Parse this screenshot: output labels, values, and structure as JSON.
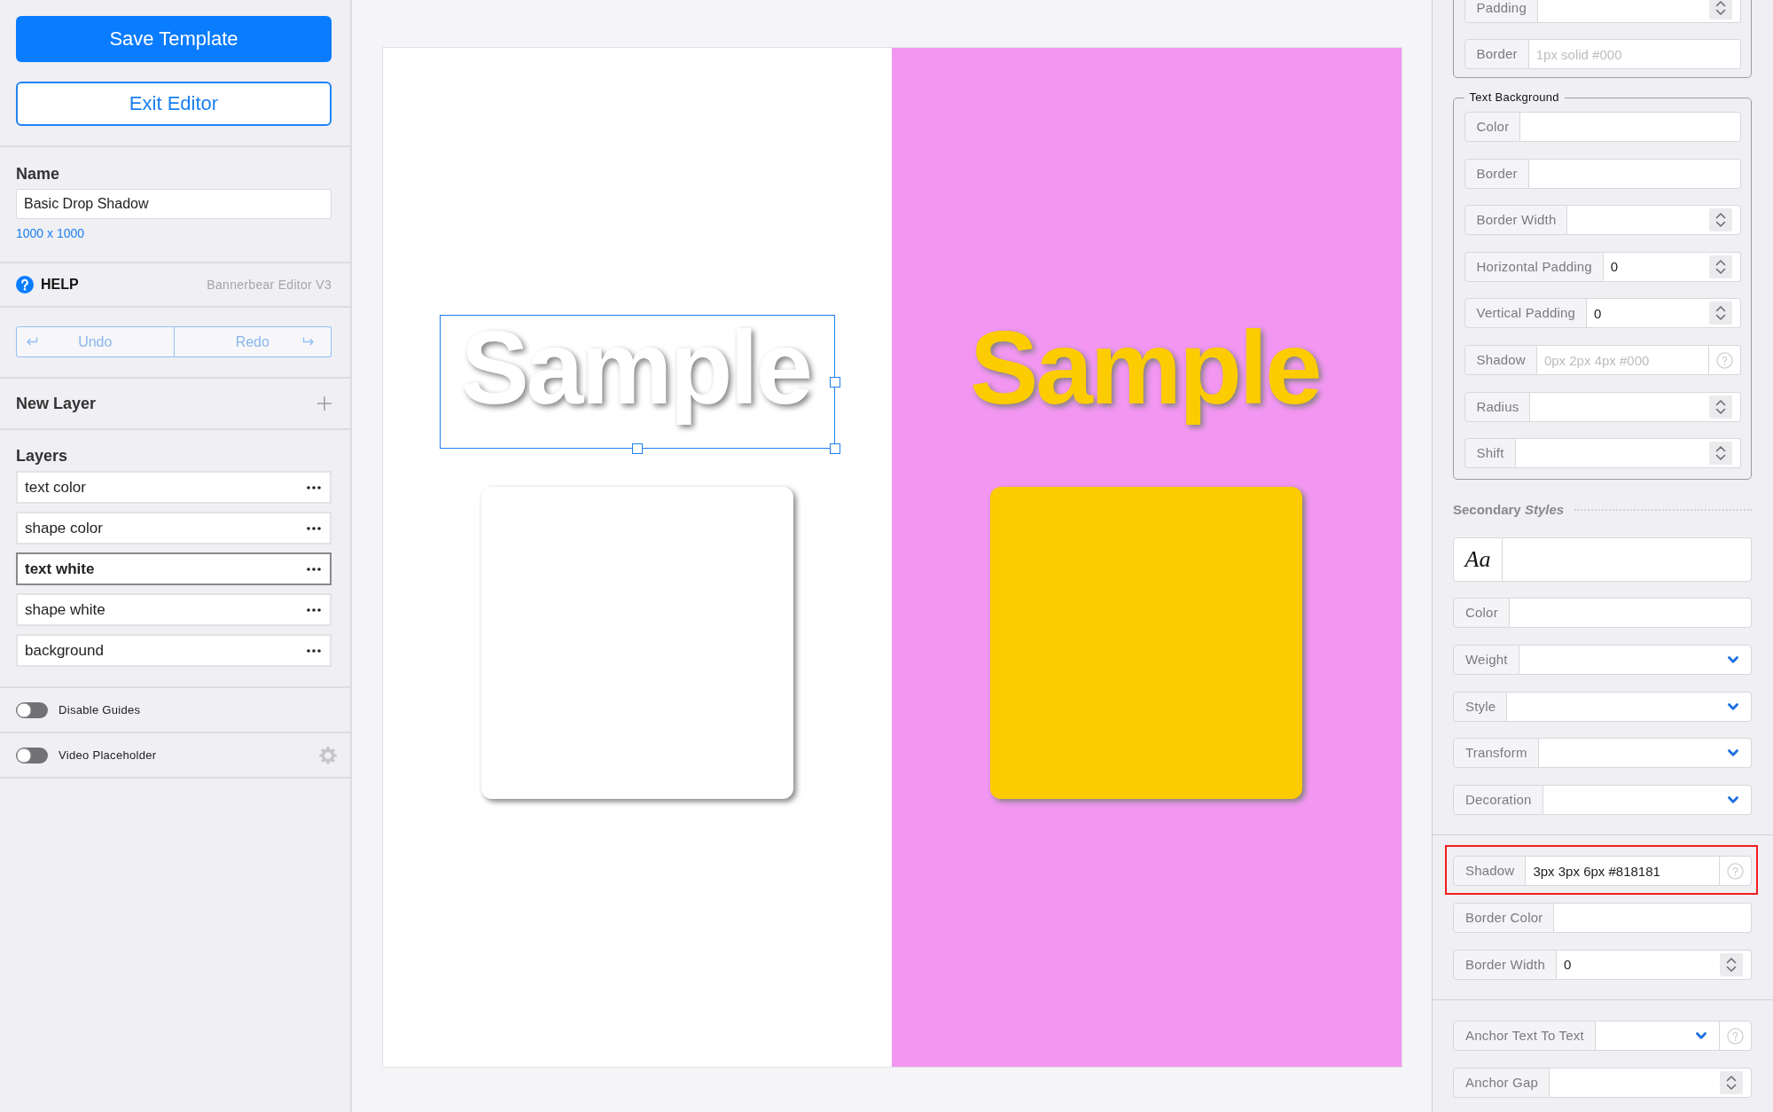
{
  "sidebar": {
    "actions": [
      {
        "label": "Save Template",
        "kind": "primary"
      },
      {
        "label": "Exit Editor",
        "kind": "outline"
      }
    ],
    "name": {
      "label": "Name",
      "value": "Basic Drop Shadow",
      "size": "1000 x 1000"
    },
    "help": {
      "label": "HELP",
      "version": "Bannerbear Editor V3"
    },
    "history": [
      {
        "label": "Undo",
        "kind": "undo",
        "disabled": true
      },
      {
        "label": "Redo",
        "kind": "redo",
        "disabled": true
      }
    ],
    "new_layer": "New Layer",
    "layers": {
      "title": "Layers",
      "items": [
        {
          "name": "text color",
          "selected": false
        },
        {
          "name": "shape color",
          "selected": false
        },
        {
          "name": "text white",
          "selected": true
        },
        {
          "name": "shape white",
          "selected": false
        },
        {
          "name": "background",
          "selected": false
        }
      ]
    },
    "toggles": [
      {
        "label": "Disable Guides",
        "on": false,
        "settings": false
      },
      {
        "label": "Video Placeholder",
        "on": false,
        "settings": true
      }
    ]
  },
  "canvas": {
    "panels": [
      {
        "color": "#ffffff",
        "items": [
          {
            "kind": "text",
            "text": "Sample",
            "color": "#ffffff",
            "selected": true
          },
          {
            "kind": "shape",
            "color": "#ffffff",
            "selected": false
          }
        ]
      },
      {
        "color": "#f296f2",
        "items": [
          {
            "kind": "text",
            "text": "Sample",
            "color": "#fdcc00",
            "selected": false
          },
          {
            "kind": "shape",
            "color": "#fdcc00",
            "selected": false
          }
        ]
      }
    ]
  },
  "properties": {
    "groups": [
      {
        "kind": "fieldset",
        "rows": [
          {
            "kind": "number",
            "label": "Padding",
            "highlighted": false
          },
          {
            "kind": "text",
            "label": "Border",
            "placeholder": "1px solid #000",
            "highlighted": false
          }
        ]
      },
      {
        "kind": "fieldset",
        "legend": "Text Background",
        "rows": [
          {
            "kind": "text",
            "label": "Color",
            "highlighted": false
          },
          {
            "kind": "text",
            "label": "Border",
            "highlighted": false
          },
          {
            "kind": "number",
            "label": "Border Width",
            "highlighted": false
          },
          {
            "kind": "number",
            "label": "Horizontal Padding",
            "value": "0",
            "highlighted": false
          },
          {
            "kind": "number",
            "label": "Vertical Padding",
            "value": "0",
            "highlighted": false
          },
          {
            "kind": "text_help",
            "label": "Shadow",
            "placeholder": "0px 2px 4px #000",
            "highlighted": false
          },
          {
            "kind": "number",
            "label": "Radius",
            "highlighted": false
          },
          {
            "kind": "number",
            "label": "Shift",
            "highlighted": false
          }
        ]
      },
      {
        "kind": "section",
        "heading": "Secondary *Styles*",
        "rows": [
          {
            "kind": "font",
            "sample": "Aa",
            "highlighted": false
          },
          {
            "kind": "text",
            "label": "Color",
            "highlighted": false
          },
          {
            "kind": "select",
            "label": "Weight",
            "highlighted": false
          },
          {
            "kind": "select",
            "label": "Style",
            "highlighted": false
          },
          {
            "kind": "select",
            "label": "Transform",
            "highlighted": false
          },
          {
            "kind": "select",
            "label": "Decoration",
            "highlighted": false
          }
        ]
      },
      {
        "kind": "section",
        "rows": [
          {
            "kind": "text_help",
            "label": "Shadow",
            "value": "3px 3px 6px #818181",
            "highlighted": true
          },
          {
            "kind": "text",
            "label": "Border Color",
            "highlighted": false
          },
          {
            "kind": "number",
            "label": "Border Width",
            "value": "0",
            "highlighted": false
          }
        ]
      },
      {
        "kind": "section",
        "rows": [
          {
            "kind": "select_help",
            "label": "Anchor Text To Text",
            "highlighted": false
          },
          {
            "kind": "number",
            "label": "Anchor Gap",
            "highlighted": false
          }
        ]
      }
    ]
  }
}
